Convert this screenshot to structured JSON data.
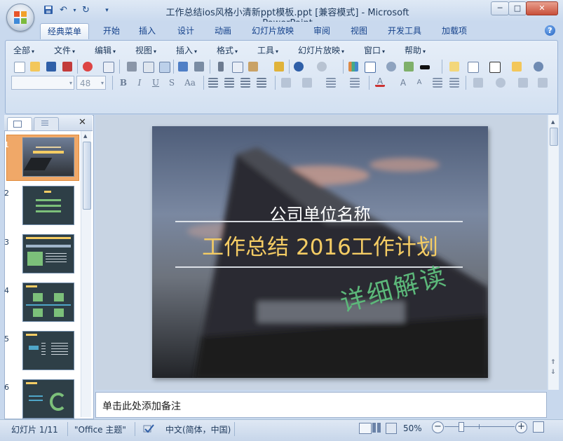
{
  "window": {
    "title": "工作总结ios风格小清新ppt模板.ppt [兼容模式] - Microsoft PowerPoint",
    "controls": {
      "minimize": "─",
      "maximize": "□",
      "close": "✕"
    }
  },
  "quick_access": {
    "save": "💾",
    "undo": "↶",
    "redo": "↻",
    "customize": "▾"
  },
  "tabs": [
    {
      "label": "经典菜单",
      "active": true
    },
    {
      "label": "开始"
    },
    {
      "label": "插入"
    },
    {
      "label": "设计"
    },
    {
      "label": "动画"
    },
    {
      "label": "幻灯片放映"
    },
    {
      "label": "审阅"
    },
    {
      "label": "视图"
    },
    {
      "label": "开发工具"
    },
    {
      "label": "加载项"
    }
  ],
  "menus": [
    "全部",
    "文件",
    "编辑",
    "视图",
    "插入",
    "格式",
    "工具",
    "幻灯片放映",
    "窗口",
    "帮助"
  ],
  "font": {
    "name": "",
    "size": "48"
  },
  "format_buttons": [
    "B",
    "I",
    "U",
    "S",
    "Aa"
  ],
  "panel": {
    "close": "✕"
  },
  "thumbnails": [
    {
      "num": "1",
      "selected": true
    },
    {
      "num": "2"
    },
    {
      "num": "3"
    },
    {
      "num": "4"
    },
    {
      "num": "5"
    },
    {
      "num": "6"
    }
  ],
  "slide": {
    "company": "公司单位名称",
    "headline": "工作总结 2016工作计划",
    "stamp": "详细解读",
    "colors": {
      "headline": "#f4cc64",
      "stamp": "#5cb87a",
      "company": "#ffffff"
    }
  },
  "notes": {
    "placeholder": "单击此处添加备注"
  },
  "status": {
    "slide_counter": "幻灯片 1/11",
    "theme": "\"Office 主题\"",
    "language": "中文(简体，中国)",
    "zoom": "50%",
    "zoom_level": 0.5
  }
}
